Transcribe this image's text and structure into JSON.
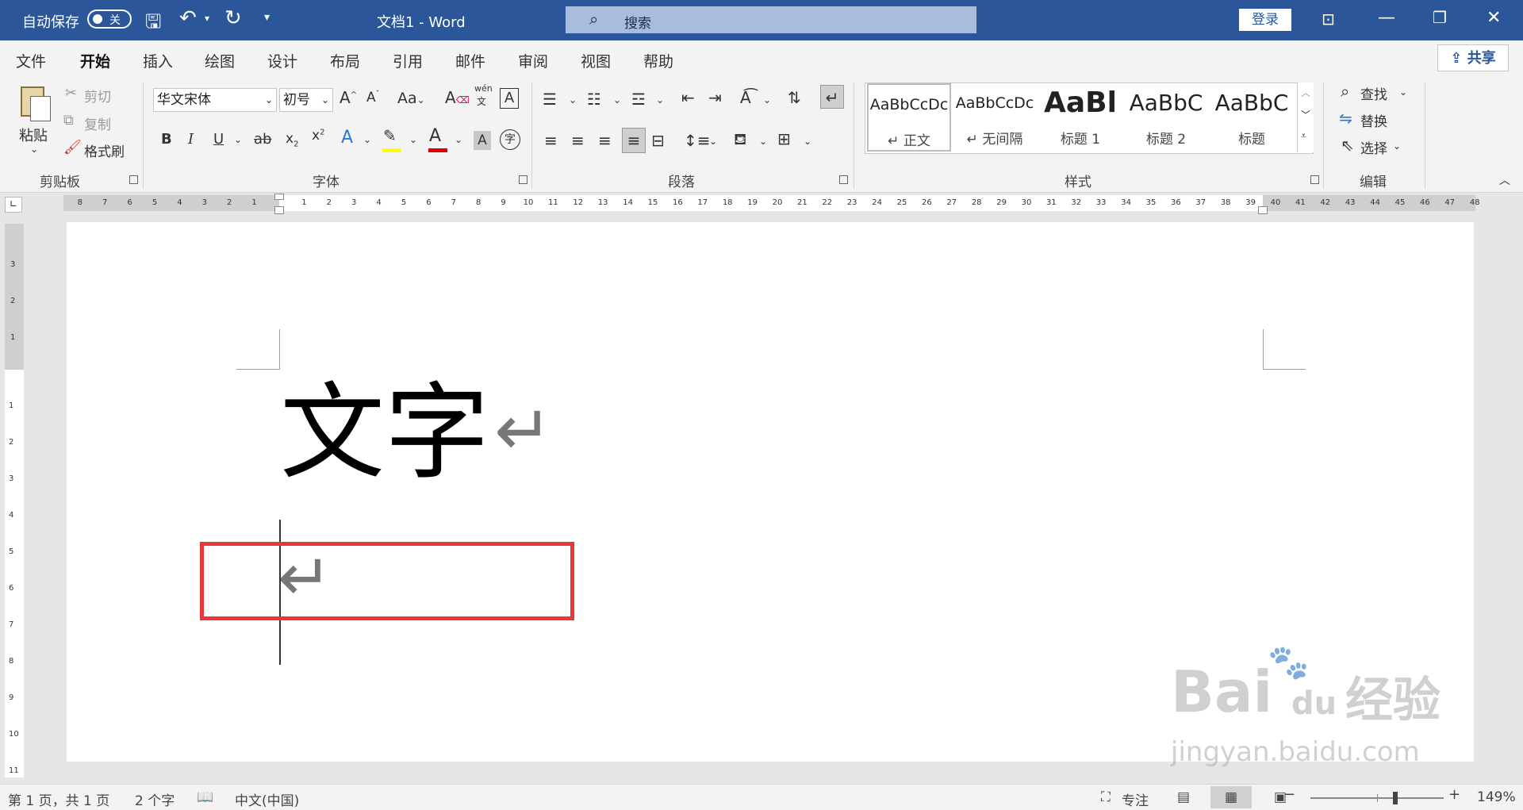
{
  "titlebar": {
    "autosave_label": "自动保存",
    "autosave_state": "关",
    "doc_title": "文档1  -  Word",
    "search_placeholder": "搜索",
    "login": "登录",
    "bg_color": "#2b579a"
  },
  "tabs": [
    "文件",
    "开始",
    "插入",
    "绘图",
    "设计",
    "布局",
    "引用",
    "邮件",
    "审阅",
    "视图",
    "帮助"
  ],
  "active_tab": "开始",
  "share": "共享",
  "ribbon": {
    "clipboard": {
      "paste": "粘贴",
      "cut": "剪切",
      "copy": "复制",
      "format_painter": "格式刷",
      "group": "剪贴板"
    },
    "font": {
      "name": "华文宋体",
      "size": "初号",
      "group": "字体",
      "aa": "Aa",
      "phonetic_top": "wén",
      "phonetic_bottom": "文",
      "char_shading": "A",
      "enclose": "字"
    },
    "paragraph": {
      "group": "段落"
    },
    "styles": {
      "group": "样式",
      "items": [
        {
          "preview": "AaBbCcDc",
          "name": "↵ 正文"
        },
        {
          "preview": "AaBbCcDc",
          "name": "↵ 无间隔"
        },
        {
          "preview": "AaBl",
          "name": "标题 1"
        },
        {
          "preview": "AaBbC",
          "name": "标题 2"
        },
        {
          "preview": "AaBbC",
          "name": "标题"
        }
      ]
    },
    "editing": {
      "find": "查找",
      "replace": "替换",
      "select": "选择",
      "group": "编辑"
    }
  },
  "ruler": {
    "left_numbers": [
      "8",
      "7",
      "6",
      "5",
      "4",
      "3",
      "2",
      "1"
    ],
    "right_numbers": [
      "1",
      "2",
      "3",
      "4",
      "5",
      "6",
      "7",
      "8",
      "9",
      "10",
      "11",
      "12",
      "13",
      "14",
      "15",
      "16",
      "17",
      "18",
      "19",
      "20",
      "21",
      "22",
      "23",
      "24",
      "25",
      "26",
      "27",
      "28",
      "29",
      "30",
      "31",
      "32",
      "33",
      "34",
      "35",
      "36",
      "37",
      "38",
      "39",
      "40",
      "41",
      "42",
      "43",
      "44",
      "45",
      "46",
      "47",
      "48"
    ],
    "vertical_top": [
      "3",
      "2",
      "1"
    ],
    "vertical_bottom": [
      "1",
      "2",
      "3",
      "4",
      "5",
      "6",
      "7",
      "8",
      "9",
      "10",
      "11"
    ]
  },
  "document": {
    "line1": "文字",
    "paragraph_mark": "↵"
  },
  "watermark": {
    "brand": "Bai",
    "du": "du",
    "cn": "经验",
    "url": "jingyan.baidu.com"
  },
  "status": {
    "page": "第 1 页，共 1 页",
    "words": "2 个字",
    "language": "中文(中国)",
    "focus": "专注",
    "zoom": "149%",
    "zoom_level_percent": 149
  },
  "colors": {
    "highlight_bar": "#ffff00",
    "font_color_bar": "#e00000",
    "red_box": "#e8363a",
    "accent": "#2b579a"
  }
}
